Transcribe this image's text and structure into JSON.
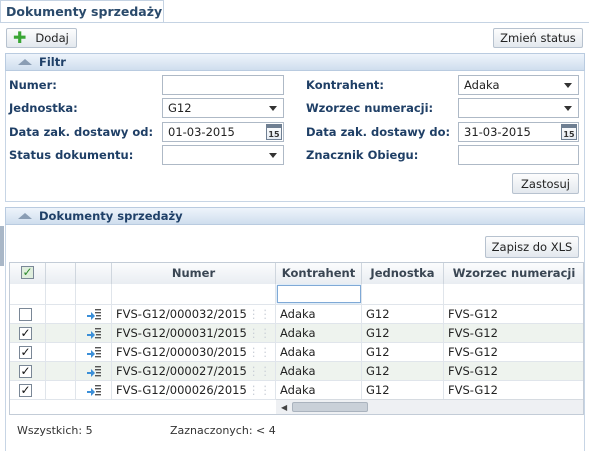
{
  "tab": {
    "title": "Dokumenty sprzedaży"
  },
  "toolbar": {
    "add_label": "Dodaj",
    "status_label": "Zmień status"
  },
  "filter": {
    "title": "Filtr",
    "numer_label": "Numer:",
    "numer_value": "",
    "jednostka_label": "Jednostka:",
    "jednostka_value": "G12",
    "data_od_label": "Data zak. dostawy od:",
    "data_od_value": "01-03-2015",
    "status_label": "Status dokumentu:",
    "status_value": "",
    "kontrahent_label": "Kontrahent:",
    "kontrahent_value": "Adaka",
    "wzorzec_label": "Wzorzec numeracji:",
    "wzorzec_value": "",
    "data_do_label": "Data zak. dostawy do:",
    "data_do_value": "31-03-2015",
    "znacznik_label": "Znacznik Obiegu:",
    "znacznik_value": "",
    "apply_label": "Zastosuj",
    "calendar_day": "15"
  },
  "list": {
    "title": "Dokumenty sprzedaży",
    "export_label": "Zapisz do XLS",
    "columns": {
      "numer": "Numer",
      "kontrahent": "Kontrahent",
      "jednostka": "Jednostka",
      "wzorzec": "Wzorzec numeracji"
    },
    "rows": [
      {
        "checked": false,
        "numer": "FVS-G12/000032/2015",
        "kontrahent": "Adaka",
        "jednostka": "G12",
        "wzorzec": "FVS-G12"
      },
      {
        "checked": true,
        "numer": "FVS-G12/000031/2015",
        "kontrahent": "Adaka",
        "jednostka": "G12",
        "wzorzec": "FVS-G12"
      },
      {
        "checked": true,
        "numer": "FVS-G12/000030/2015",
        "kontrahent": "Adaka",
        "jednostka": "G12",
        "wzorzec": "FVS-G12"
      },
      {
        "checked": true,
        "numer": "FVS-G12/000027/2015",
        "kontrahent": "Adaka",
        "jednostka": "G12",
        "wzorzec": "FVS-G12"
      },
      {
        "checked": true,
        "numer": "FVS-G12/000026/2015",
        "kontrahent": "Adaka",
        "jednostka": "G12",
        "wzorzec": "FVS-G12"
      }
    ],
    "footer_total": "Wszystkich: 5",
    "footer_selected": "Zaznaczonych: < 4"
  },
  "colors": {
    "accent": "#1f4068",
    "add_green": "#3aa635"
  }
}
